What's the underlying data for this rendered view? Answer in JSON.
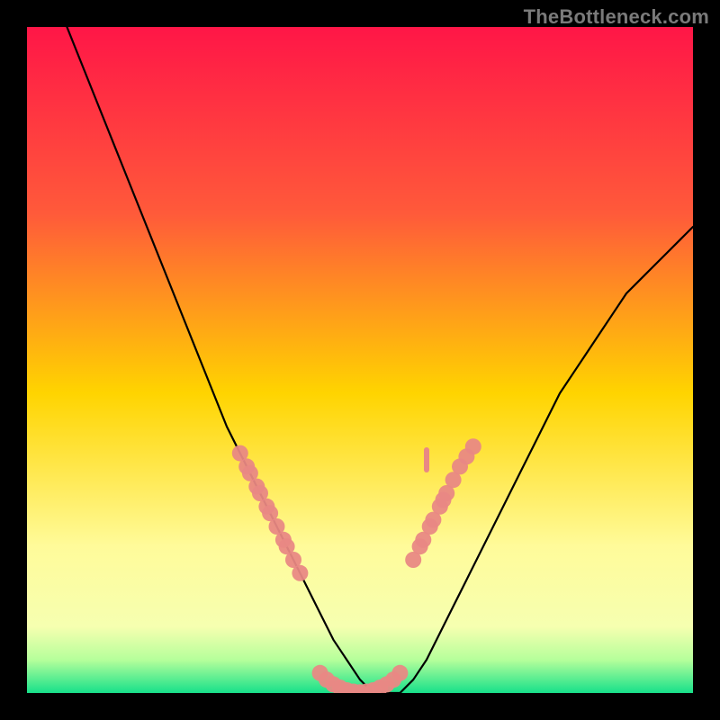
{
  "watermark": "TheBottleneck.com",
  "chart_data": {
    "type": "line",
    "title": "",
    "xlabel": "",
    "ylabel": "",
    "xlim": [
      0,
      100
    ],
    "ylim": [
      0,
      100
    ],
    "grid": false,
    "legend": false,
    "background_gradient_stops": [
      {
        "pct": 0,
        "color": "#ff1647"
      },
      {
        "pct": 28,
        "color": "#ff5a3a"
      },
      {
        "pct": 55,
        "color": "#ffd400"
      },
      {
        "pct": 78,
        "color": "#fffb9a"
      },
      {
        "pct": 90,
        "color": "#f6ffb0"
      },
      {
        "pct": 95,
        "color": "#b6ff9b"
      },
      {
        "pct": 100,
        "color": "#17e08a"
      }
    ],
    "series": [
      {
        "name": "bottleneck-curve",
        "stroke": "#000000",
        "marker": "none",
        "x": [
          6,
          8,
          10,
          12,
          14,
          16,
          18,
          20,
          22,
          24,
          26,
          28,
          30,
          32,
          34,
          36,
          38,
          40,
          42,
          44,
          46,
          48,
          50,
          52,
          54,
          56,
          58,
          60,
          62,
          64,
          66,
          68,
          70,
          72,
          74,
          76,
          78,
          80,
          82,
          84,
          86,
          88,
          90,
          92,
          94,
          96,
          98,
          100
        ],
        "y": [
          100,
          95,
          90,
          85,
          80,
          75,
          70,
          65,
          60,
          55,
          50,
          45,
          40,
          36,
          32,
          28,
          24,
          20,
          16,
          12,
          8,
          5,
          2,
          0,
          0,
          0,
          2,
          5,
          9,
          13,
          17,
          21,
          25,
          29,
          33,
          37,
          41,
          45,
          48,
          51,
          54,
          57,
          60,
          62,
          64,
          66,
          68,
          70
        ]
      },
      {
        "name": "left-cluster-markers",
        "stroke": "none",
        "marker": "circle",
        "color": "#e98884",
        "x": [
          32,
          33,
          33.5,
          34.5,
          35,
          36,
          36.5,
          37.5,
          38.5,
          39,
          40,
          41
        ],
        "y": [
          36,
          34,
          33,
          31,
          30,
          28,
          27,
          25,
          23,
          22,
          20,
          18
        ]
      },
      {
        "name": "right-cluster-markers",
        "stroke": "none",
        "marker": "circle",
        "color": "#e98884",
        "x": [
          58,
          59,
          59.5,
          60.5,
          61,
          62,
          62.5,
          63,
          64,
          65,
          66,
          67
        ],
        "y": [
          20,
          22,
          23,
          25,
          26,
          28,
          29,
          30,
          32,
          34,
          35.5,
          37
        ]
      },
      {
        "name": "right-tick-marker",
        "stroke": "none",
        "marker": "vtick",
        "color": "#e98884",
        "x": [
          60
        ],
        "y": [
          35
        ]
      },
      {
        "name": "valley-markers",
        "stroke": "none",
        "marker": "circle",
        "color": "#e98884",
        "x": [
          44,
          45,
          46,
          47,
          48,
          49,
          50,
          51,
          52,
          53,
          54,
          55,
          56
        ],
        "y": [
          3,
          2,
          1.3,
          0.8,
          0.4,
          0.2,
          0.1,
          0.2,
          0.4,
          0.8,
          1.3,
          2,
          3
        ]
      }
    ]
  }
}
